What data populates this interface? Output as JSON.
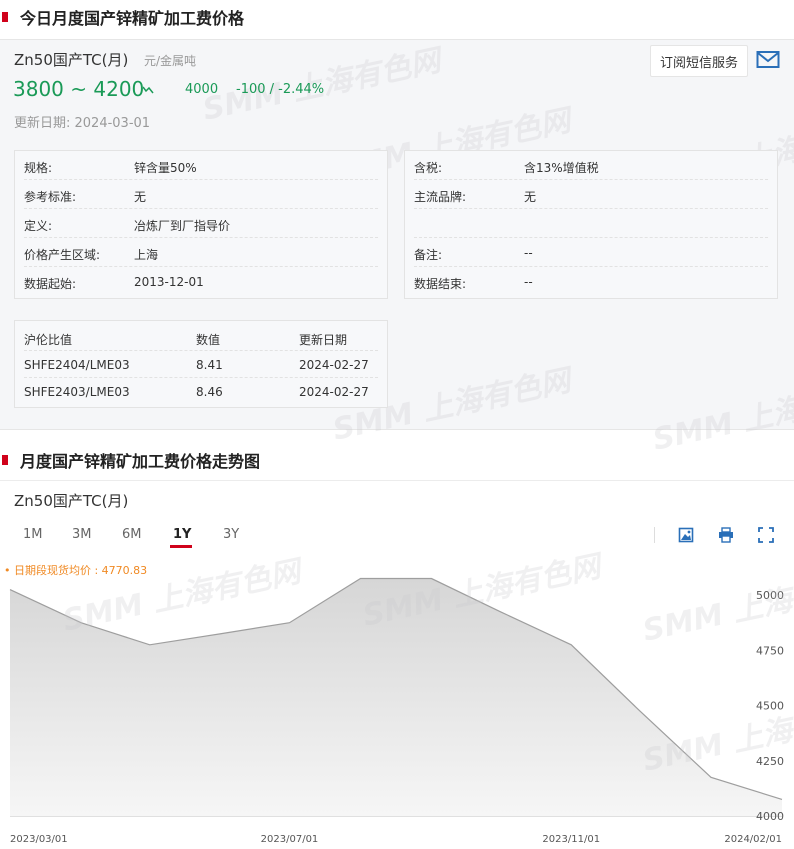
{
  "section1": {
    "title": "今日月度国产锌精矿加工费价格"
  },
  "product": {
    "name": "Zn50国产TC(月)",
    "unit": "元/金属吨",
    "price_range": "3800 ~ 4200",
    "average": "4000",
    "change": "-100  /  -2.44%",
    "update_date": "更新日期:  2024-03-01",
    "subscribe_label": "订阅短信服务",
    "mail_icon": "mail-icon",
    "trend_icon": "down-trend-icon"
  },
  "specs_left": [
    {
      "k": "规格:",
      "v": "锌含量50%"
    },
    {
      "k": "参考标准:",
      "v": "无"
    },
    {
      "k": "定义:",
      "v": "冶炼厂到厂指导价"
    },
    {
      "k": "价格产生区域:",
      "v": "上海"
    },
    {
      "k": "数据起始:",
      "v": "2013-12-01"
    }
  ],
  "specs_right": [
    {
      "k": "含税:",
      "v": "含13%增值税"
    },
    {
      "k": "主流品牌:",
      "v": "无"
    },
    {
      "k": "",
      "v": ""
    },
    {
      "k": "备注:",
      "v": "--"
    },
    {
      "k": "数据结束:",
      "v": "--"
    }
  ],
  "ratio_table": {
    "headers": [
      "沪伦比值",
      "数值",
      "更新日期"
    ],
    "rows": [
      [
        "SHFE2404/LME03",
        "8.41",
        "2024-02-27"
      ],
      [
        "SHFE2403/LME03",
        "8.46",
        "2024-02-27"
      ]
    ]
  },
  "watermark": "SMM 上海有色网",
  "section2": {
    "title": "月度国产锌精矿加工费价格走势图"
  },
  "chart": {
    "title": "Zn50国产TC(月)",
    "range_tabs": [
      "1M",
      "3M",
      "6M",
      "1Y",
      "3Y"
    ],
    "active_tab": "1Y",
    "avg_label": "• 日期段现货均价 : 4770.83",
    "tools": [
      "download-image-icon",
      "print-icon",
      "fullscreen-icon"
    ]
  },
  "chart_data": {
    "type": "area",
    "x": [
      "2023-03-01",
      "2023-04-01",
      "2023-05-01",
      "2023-06-01",
      "2023-07-01",
      "2023-08-01",
      "2023-09-01",
      "2023-10-01",
      "2023-11-01",
      "2023-12-01",
      "2024-01-01",
      "2024-02-01"
    ],
    "values": [
      5025,
      4875,
      4775,
      4825,
      4875,
      5075,
      5075,
      4925,
      4775,
      4475,
      4175,
      4075
    ],
    "ylim": [
      4000,
      5100
    ],
    "yticks": [
      4000,
      4250,
      4500,
      4750,
      5000
    ],
    "xtick_labels": [
      "2023/03/01",
      "2023/07/01",
      "2023/11/01",
      "2024/02/01"
    ],
    "xtick_dates": [
      "2023-03-01",
      "2023-07-01",
      "2023-11-01",
      "2024-02-01"
    ],
    "grid": false,
    "colors": {
      "line": "#9e9e9e",
      "fill_top": "#d6d6d6",
      "fill_bottom": "#f6f6f6"
    }
  }
}
